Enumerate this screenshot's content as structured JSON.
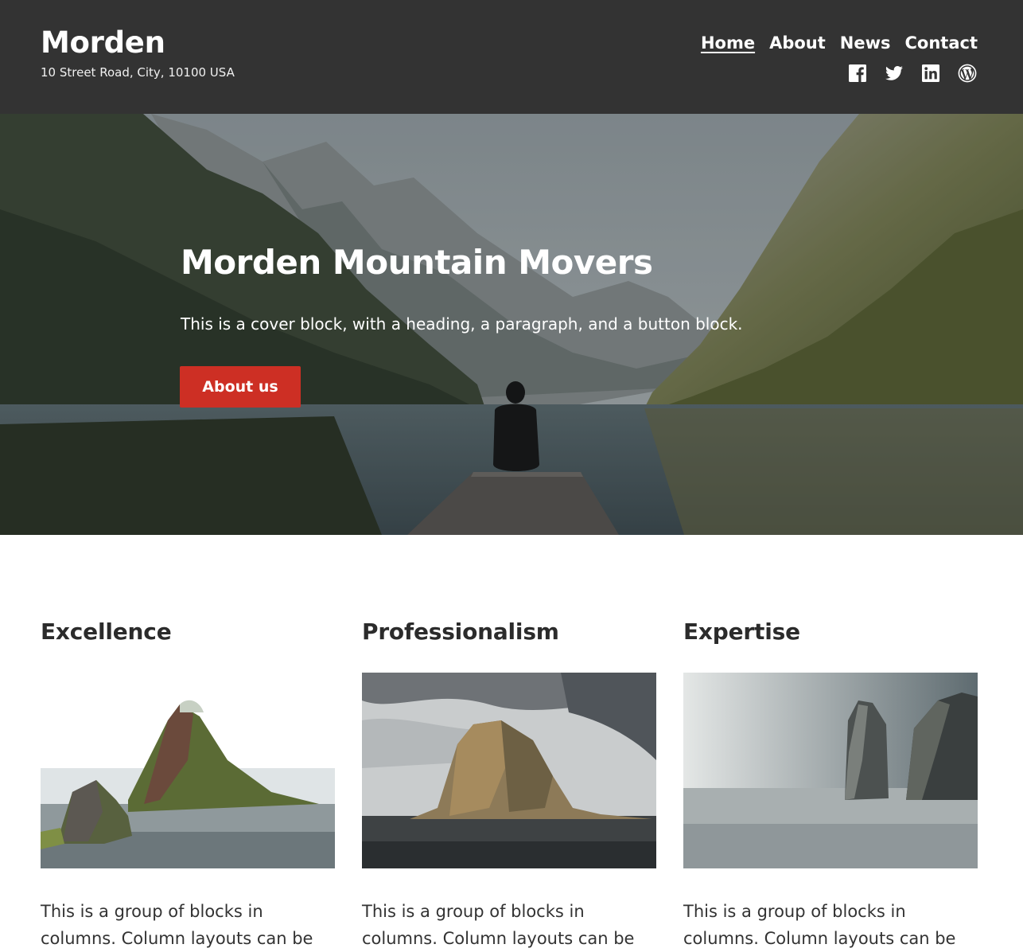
{
  "header": {
    "site_title": "Morden",
    "address": "10 Street Road, City, 10100 USA",
    "nav": [
      {
        "label": "Home",
        "current": true
      },
      {
        "label": "About"
      },
      {
        "label": "News"
      },
      {
        "label": "Contact"
      }
    ],
    "social": [
      {
        "icon": "facebook-icon"
      },
      {
        "icon": "twitter-icon"
      },
      {
        "icon": "linkedin-icon"
      },
      {
        "icon": "wordpress-icon"
      }
    ]
  },
  "cover": {
    "heading": "Morden Mountain Movers",
    "text": "This is a cover block, with a heading, a paragraph, and a button block.",
    "button_label": "About us",
    "button_color": "#cd2f24"
  },
  "columns": [
    {
      "heading": "Excellence",
      "text": "This is a group of blocks in columns. Column layouts can be"
    },
    {
      "heading": "Professionalism",
      "text": "This is a group of blocks in columns. Column layouts can be"
    },
    {
      "heading": "Expertise",
      "text": "This is a group of blocks in columns. Column layouts can be"
    }
  ],
  "colors": {
    "header_background": "#333333",
    "text": "#2b2b2b",
    "accent": "#cd2f24"
  }
}
